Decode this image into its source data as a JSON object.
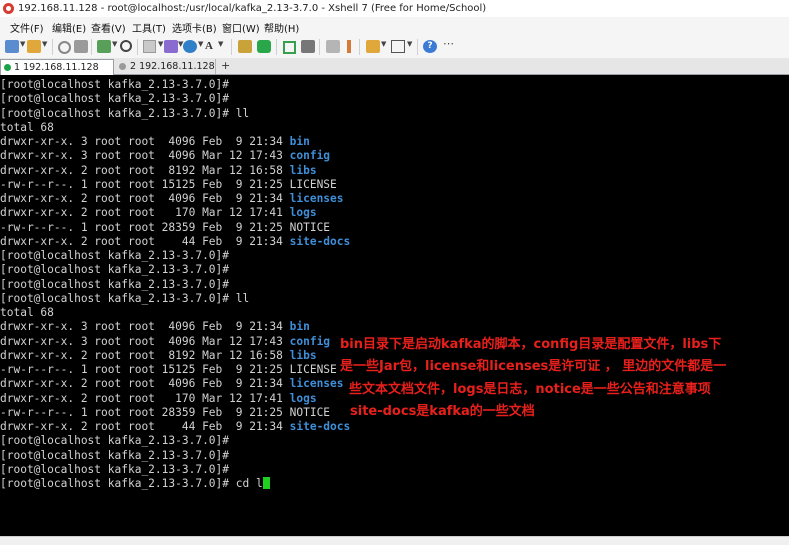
{
  "window": {
    "title": "192.168.11.128 - root@localhost:/usr/local/kafka_2.13-3.7.0 - Xshell 7 (Free for Home/School)"
  },
  "menu": {
    "file": "文件(F)",
    "edit": "编辑(E)",
    "view": "查看(V)",
    "tools": "工具(T)",
    "tab": "选项卡(B)",
    "window": "窗口(W)",
    "help": "帮助(H)"
  },
  "tabs": [
    {
      "label": "1 192.168.11.128",
      "active": true
    },
    {
      "label": "2 192.168.11.128",
      "active": false
    }
  ],
  "tab_add": "+",
  "terminal": {
    "lines": [
      {
        "text": "[root@localhost kafka_2.13-3.7.0]#"
      },
      {
        "text": "[root@localhost kafka_2.13-3.7.0]#"
      },
      {
        "text": "[root@localhost kafka_2.13-3.7.0]# ll"
      },
      {
        "text": "total 68"
      },
      {
        "text": "drwxr-xr-x. 3 root root  4096 Feb  9 21:34 ",
        "name": "bin",
        "dir": true
      },
      {
        "text": "drwxr-xr-x. 3 root root  4096 Mar 12 17:43 ",
        "name": "config",
        "dir": true
      },
      {
        "text": "drwxr-xr-x. 2 root root  8192 Mar 12 16:58 ",
        "name": "libs",
        "dir": true
      },
      {
        "text": "-rw-r--r--. 1 root root 15125 Feb  9 21:25 ",
        "name": "LICENSE",
        "dir": false
      },
      {
        "text": "drwxr-xr-x. 2 root root  4096 Feb  9 21:34 ",
        "name": "licenses",
        "dir": true
      },
      {
        "text": "drwxr-xr-x. 2 root root   170 Mar 12 17:41 ",
        "name": "logs",
        "dir": true
      },
      {
        "text": "-rw-r--r--. 1 root root 28359 Feb  9 21:25 ",
        "name": "NOTICE",
        "dir": false
      },
      {
        "text": "drwxr-xr-x. 2 root root    44 Feb  9 21:34 ",
        "name": "site-docs",
        "dir": true
      },
      {
        "text": "[root@localhost kafka_2.13-3.7.0]#"
      },
      {
        "text": "[root@localhost kafka_2.13-3.7.0]#"
      },
      {
        "text": "[root@localhost kafka_2.13-3.7.0]#"
      },
      {
        "text": "[root@localhost kafka_2.13-3.7.0]# ll"
      },
      {
        "text": "total 68"
      },
      {
        "text": "drwxr-xr-x. 3 root root  4096 Feb  9 21:34 ",
        "name": "bin",
        "dir": true
      },
      {
        "text": "drwxr-xr-x. 3 root root  4096 Mar 12 17:43 ",
        "name": "config",
        "dir": true
      },
      {
        "text": "drwxr-xr-x. 2 root root  8192 Mar 12 16:58 ",
        "name": "libs",
        "dir": true
      },
      {
        "text": "-rw-r--r--. 1 root root 15125 Feb  9 21:25 ",
        "name": "LICENSE",
        "dir": false
      },
      {
        "text": "drwxr-xr-x. 2 root root  4096 Feb  9 21:34 ",
        "name": "licenses",
        "dir": true
      },
      {
        "text": "drwxr-xr-x. 2 root root   170 Mar 12 17:41 ",
        "name": "logs",
        "dir": true
      },
      {
        "text": "-rw-r--r--. 1 root root 28359 Feb  9 21:25 ",
        "name": "NOTICE",
        "dir": false
      },
      {
        "text": "drwxr-xr-x. 2 root root    44 Feb  9 21:34 ",
        "name": "site-docs",
        "dir": true
      },
      {
        "text": "[root@localhost kafka_2.13-3.7.0]#"
      },
      {
        "text": "[root@localhost kafka_2.13-3.7.0]#"
      },
      {
        "text": "[root@localhost kafka_2.13-3.7.0]#"
      },
      {
        "text": "[root@localhost kafka_2.13-3.7.0]# cd l",
        "cursor": true
      }
    ]
  },
  "annotation": {
    "line1": "bin目录下是启动kafka的脚本，config目录是配置文件，libs下",
    "line2": "是一些Jar包，license和licenses是许可证 ， 里边的文件都是一",
    "line3": "些文本文档文件，logs是日志，notice是一些公告和注意事项",
    "line4": "site-docs是kafka的一些文档"
  },
  "colors": {
    "terminal_bg": "#000000",
    "terminal_text": "#d2d2d2",
    "directory": "#3f8ed8",
    "annotation": "#e8201c",
    "cursor": "#20d020"
  }
}
